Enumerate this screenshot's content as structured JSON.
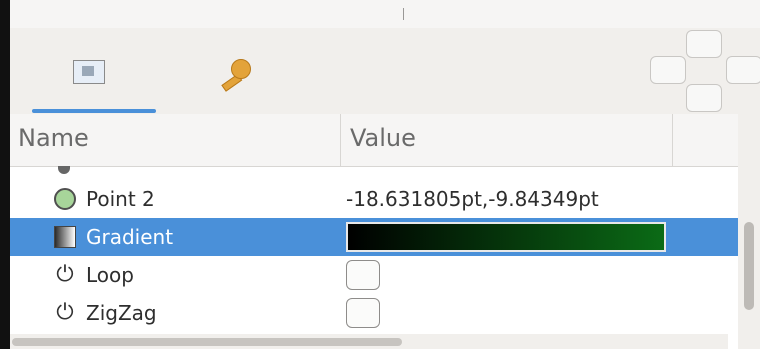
{
  "tabs": [
    {
      "name": "params-tab",
      "icon": "params-icon"
    },
    {
      "name": "library-tab",
      "icon": "key-icon"
    }
  ],
  "columns": {
    "name": "Name",
    "value": "Value"
  },
  "rows": [
    {
      "label": "Point 2",
      "value": "-18.631805pt,-9.84349pt",
      "icon": "circle-icon"
    },
    {
      "label": "Gradient",
      "value": "",
      "icon": "gradient-icon",
      "selected": true,
      "gradient": {
        "from": "#000000",
        "to": "#0b6b16"
      }
    },
    {
      "label": "Loop",
      "icon": "power-icon",
      "checked": false
    },
    {
      "label": "ZigZag",
      "icon": "power-icon",
      "checked": false
    }
  ],
  "colors": {
    "selection": "#4a90d9",
    "tab_active": "#4a90d9"
  }
}
